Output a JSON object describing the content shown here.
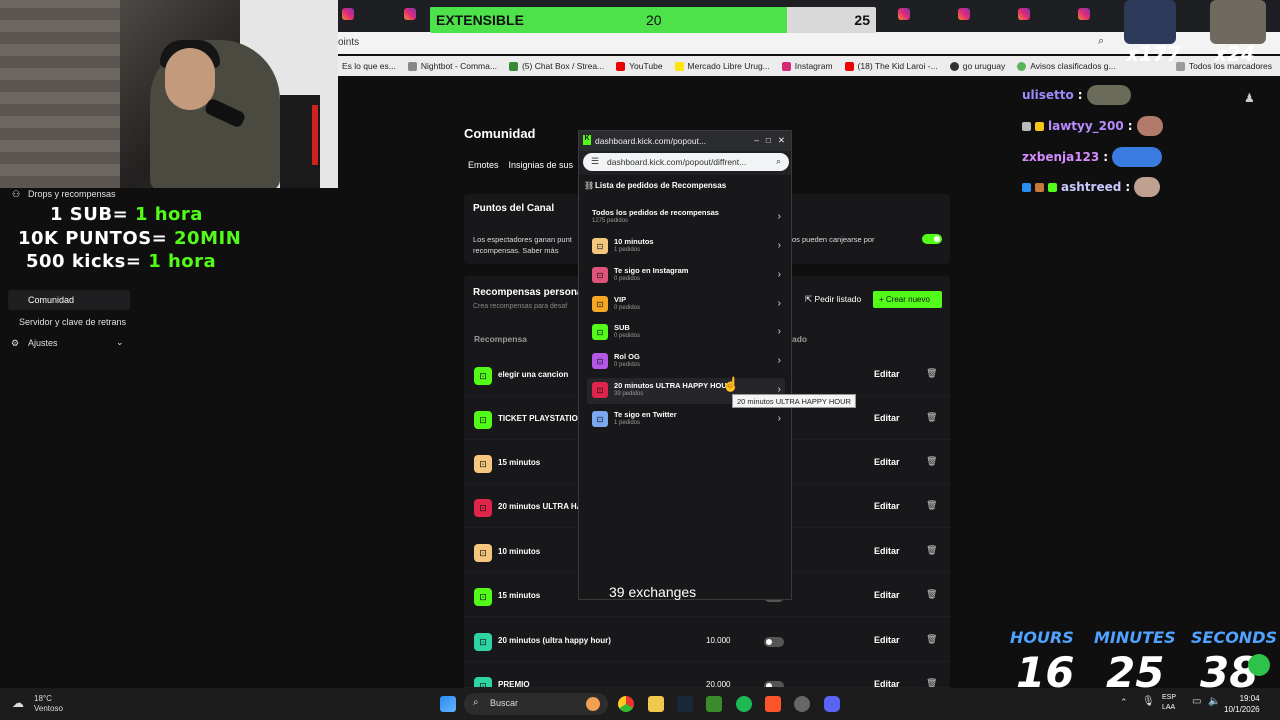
{
  "goal": {
    "label": "EXTENSIBLE",
    "current": "20",
    "target": "25",
    "progress": 0.8
  },
  "browser": {
    "url": "oints",
    "bookmarks": [
      "Es lo que es...",
      "Nightbot - Comma...",
      "(5) Chat Box / Strea...",
      "YouTube",
      "Mercado Libre Urug...",
      "Instagram",
      "(18) The Kid Laroi -...",
      "go uruguay",
      "Avisos clasificados g..."
    ],
    "bookmarks_folder": "Todos los marcadores"
  },
  "overlay_counters": {
    "left": "x177",
    "right": "x24"
  },
  "promo": {
    "lines": [
      {
        "a": "1 SUB= ",
        "b": "1 hora"
      },
      {
        "a": "10K PUNTOS= ",
        "b": "20MIN"
      },
      {
        "a": "500 kicks= ",
        "b": "1 hora"
      }
    ]
  },
  "sidebar": {
    "drops": "Drops y recompensas",
    "comunidad": "Comunidad",
    "servidor": "Servidor y clave de retrans",
    "ajustes": "Ajustes"
  },
  "main": {
    "title": "Comunidad",
    "tabs": [
      "Emotes",
      "Insignias de sus"
    ],
    "points_title": "Puntos del Canal",
    "points_desc_a": "Los espectadores ganan punt",
    "points_desc_b": "recompensas. Saber más",
    "points_desc_c": "os pueden canjearse por",
    "rewards_title": "Recompensas persona",
    "rewards_sub": "Crea recompensas para desaf",
    "pedir_listado": "Pedir listado",
    "crear_nuevo": "Crear nuevo",
    "col_reward": "Recompensa",
    "col_state": "ado",
    "edit_label": "Editar",
    "rows": [
      {
        "name": "elegir una cancion",
        "cost": "",
        "color": "#53fc18",
        "toggle": "hidden"
      },
      {
        "name": "TICKET PLAYSTATION",
        "cost": "",
        "color": "#53fc18",
        "toggle": "hidden"
      },
      {
        "name": "15 minutos",
        "cost": "",
        "color": "#f5c77e",
        "toggle": "hidden"
      },
      {
        "name": "20 minutos ULTRA HA",
        "cost": "",
        "color": "#e0244a",
        "toggle": "hidden"
      },
      {
        "name": "10 minutos",
        "cost": "",
        "color": "#f5c77e",
        "toggle": "hidden"
      },
      {
        "name": "15 minutos",
        "cost": "",
        "color": "#53fc18",
        "toggle": "off"
      },
      {
        "name": "20 minutos (ultra happy hour)",
        "cost": "10.000",
        "color": "#2fd4a4",
        "toggle": "off"
      },
      {
        "name": "PREMIO",
        "cost": "20.000",
        "color": "#2fd4a4",
        "toggle": "off"
      }
    ]
  },
  "popout": {
    "window_title": "dashboard.kick.com/popout...",
    "url": "dashboard.kick.com/popout/diffrent...",
    "heading": "Lista de pedidos de Recompensas",
    "items": [
      {
        "name": "Todos los pedidos de recompensas",
        "count": "1275 pedidos",
        "color": ""
      },
      {
        "name": "10 minutos",
        "count": "1 pedidos",
        "color": "#f5c77e"
      },
      {
        "name": "Te sigo en Instagram",
        "count": "0 pedidos",
        "color": "#e0547a"
      },
      {
        "name": "VIP",
        "count": "0 pedidos",
        "color": "#f5a623"
      },
      {
        "name": "SUB",
        "count": "0 pedidos",
        "color": "#53fc18"
      },
      {
        "name": "Rol OG",
        "count": "0 pedidos",
        "color": "#b456e6"
      },
      {
        "name": "20 minutos ULTRA HAPPY HOUR",
        "count": "39 pedidos",
        "color": "#e0244a"
      },
      {
        "name": "Te sigo en Twitter",
        "count": "1 pedidos",
        "color": "#7ba7f0"
      }
    ],
    "tooltip": "20 minutos ULTRA HAPPY HOUR",
    "exchanges": "39 exchanges"
  },
  "chat": [
    {
      "user": "ulisetto",
      "color": "#9e8cff"
    },
    {
      "user": "lawtyy_200",
      "color": "#b98cff"
    },
    {
      "user": "zxbenja123",
      "color": "#d58cff"
    },
    {
      "user": "ashtreed",
      "color": "#c9c9ff"
    }
  ],
  "timer": {
    "hours_label": "HOURS",
    "minutes_label": "MINUTES",
    "seconds_label": "SECONDS",
    "hours": "16",
    "minutes": "25",
    "seconds": "38"
  },
  "taskbar": {
    "temp": "18°C",
    "weather": "Ventoso",
    "search": "Buscar",
    "lang1": "ESP",
    "lang2": "LAA",
    "time": "19:04",
    "date": "10/1/2026"
  }
}
